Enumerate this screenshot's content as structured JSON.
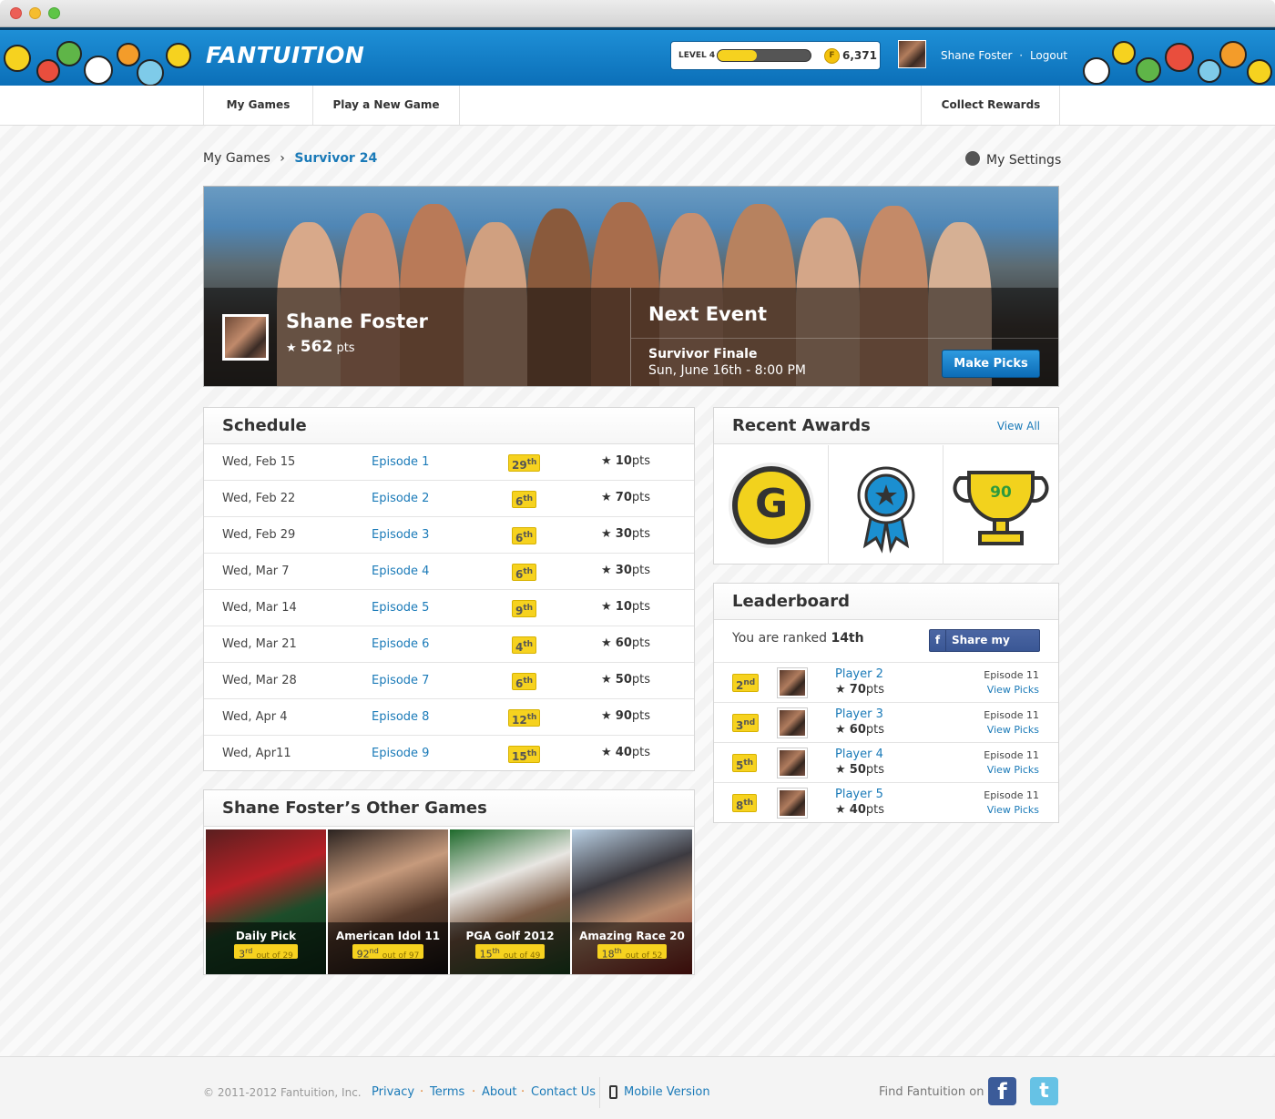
{
  "header": {
    "logo": "FANTUITION",
    "level_label": "LEVEL 4",
    "level_progress": 0.42,
    "coin_symbol": "F",
    "coins": "6,371",
    "username": "Shane Foster",
    "logout": "Logout",
    "separator": "·"
  },
  "nav": {
    "my_games": "My Games",
    "play_new": "Play a New Game",
    "collect_rewards": "Collect Rewards"
  },
  "breadcrumb": {
    "parent": "My Games",
    "sep": "›",
    "current": "Survivor 24"
  },
  "settings_label": "My Settings",
  "hero": {
    "name": "Shane Foster",
    "points": "562",
    "points_unit": "pts",
    "next_title": "Next Event",
    "event_name": "Survivor Finale",
    "event_time": "Sun, June 16th - 8:00 PM",
    "make_picks": "Make Picks"
  },
  "schedule": {
    "title": "Schedule",
    "rows": [
      {
        "date": "Wed, Feb 15",
        "episode": "Episode 1",
        "rank": "29",
        "suffix": "th",
        "pts": "10",
        "unit": "pts"
      },
      {
        "date": "Wed, Feb 22",
        "episode": "Episode 2",
        "rank": "6",
        "suffix": "th",
        "pts": "70",
        "unit": "pts"
      },
      {
        "date": "Wed, Feb 29",
        "episode": "Episode 3",
        "rank": "6",
        "suffix": "th",
        "pts": "30",
        "unit": "pts"
      },
      {
        "date": "Wed, Mar 7",
        "episode": "Episode 4",
        "rank": "6",
        "suffix": "th",
        "pts": "30",
        "unit": "pts"
      },
      {
        "date": "Wed, Mar 14",
        "episode": "Episode 5",
        "rank": "9",
        "suffix": "th",
        "pts": "10",
        "unit": "pts"
      },
      {
        "date": "Wed, Mar 21",
        "episode": "Episode 6",
        "rank": "4",
        "suffix": "th",
        "pts": "60",
        "unit": "pts"
      },
      {
        "date": "Wed, Mar 28",
        "episode": "Episode 7",
        "rank": "6",
        "suffix": "th",
        "pts": "50",
        "unit": "pts"
      },
      {
        "date": "Wed, Apr 4",
        "episode": "Episode 8",
        "rank": "12",
        "suffix": "th",
        "pts": "90",
        "unit": "pts"
      },
      {
        "date": "Wed, Apr11",
        "episode": "Episode 9",
        "rank": "15",
        "suffix": "th",
        "pts": "40",
        "unit": "pts"
      }
    ]
  },
  "awards": {
    "title": "Recent Awards",
    "view_all": "View All",
    "g_letter": "G",
    "trophy_number": "90"
  },
  "leaderboard": {
    "title": "Leaderboard",
    "rank_prefix": "You are ranked",
    "rank_value": "14th",
    "share_label": "Share my Rank",
    "share_icon": "f",
    "rows": [
      {
        "rank": "2",
        "suffix": "nd",
        "name": "Player 2",
        "pts": "70",
        "unit": "pts",
        "episode": "Episode 11",
        "view": "View Picks"
      },
      {
        "rank": "3",
        "suffix": "nd",
        "name": "Player 3",
        "pts": "60",
        "unit": "pts",
        "episode": "Episode 11",
        "view": "View Picks"
      },
      {
        "rank": "5",
        "suffix": "th",
        "name": "Player 4",
        "pts": "50",
        "unit": "pts",
        "episode": "Episode 11",
        "view": "View Picks"
      },
      {
        "rank": "8",
        "suffix": "th",
        "name": "Player 5",
        "pts": "40",
        "unit": "pts",
        "episode": "Episode 11",
        "view": "View Picks"
      }
    ]
  },
  "other_games": {
    "title": "Shane Foster’s Other Games",
    "games": [
      {
        "name": "Daily Pick",
        "rank": "3",
        "suffix": "rd",
        "of": "out of 29"
      },
      {
        "name": "American Idol 11",
        "rank": "92",
        "suffix": "nd",
        "of": "out of 97"
      },
      {
        "name": "PGA Golf 2012",
        "rank": "15",
        "suffix": "th",
        "of": "out of 49"
      },
      {
        "name": "Amazing Race 20",
        "rank": "18",
        "suffix": "th",
        "of": "out of 52"
      }
    ]
  },
  "footer": {
    "copyright": "© 2011-2012 Fantuition, Inc.",
    "privacy": "Privacy",
    "terms": "Terms",
    "about": "About",
    "contact": "Contact Us",
    "mobile": "Mobile Version",
    "dot": "·",
    "find": "Find Fantuition on",
    "fb_icon": "f",
    "tw_icon": "t"
  },
  "colors": {
    "brand_blue": "#0b6fb8",
    "link_blue": "#1a7ab8",
    "badge_yellow": "#f6d21f"
  }
}
